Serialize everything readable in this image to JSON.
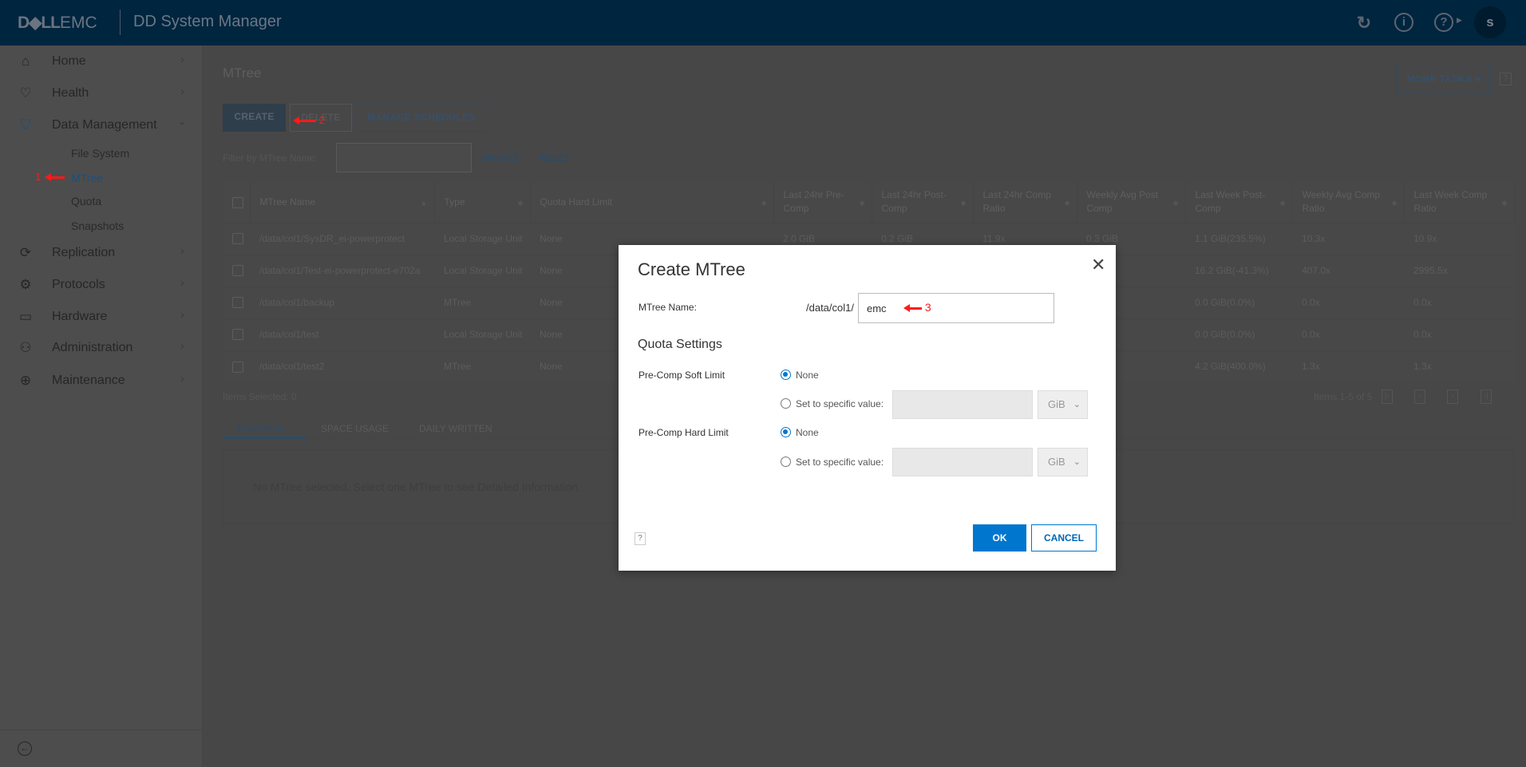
{
  "header": {
    "logo_bold": "D◆LL",
    "logo_light": "EMC",
    "title": "DD System Manager",
    "avatar": "s",
    "icons": [
      "refresh-icon",
      "info-icon",
      "help-icon"
    ]
  },
  "sidebar": {
    "items": [
      {
        "label": "Home",
        "icon": "home-icon"
      },
      {
        "label": "Health",
        "icon": "heart-icon"
      },
      {
        "label": "Data Management",
        "icon": "shield-icon",
        "expanded": true,
        "children": [
          "File System",
          "MTree",
          "Quota",
          "Snapshots"
        ],
        "active_child": "MTree"
      },
      {
        "label": "Replication",
        "icon": "sync-icon"
      },
      {
        "label": "Protocols",
        "icon": "protocols-icon"
      },
      {
        "label": "Hardware",
        "icon": "hardware-icon"
      },
      {
        "label": "Administration",
        "icon": "admin-icon"
      },
      {
        "label": "Maintenance",
        "icon": "maintenance-icon"
      }
    ]
  },
  "annotations": {
    "a1": "1",
    "a2": "2",
    "a3": "3"
  },
  "main": {
    "title": "MTree",
    "create": "CREATE",
    "delete": "DELETE",
    "manage": "MANAGE SCHEDULES",
    "more_tasks": "MORE TASKS",
    "help": "?",
    "filter_label": "Filter by MTree Name:",
    "filter_value": "",
    "update": "UPDATE",
    "reset": "RESET",
    "columns": [
      "MTree Name",
      "Type",
      "Quota Hard Limit",
      "Last 24hr Pre-Comp",
      "Last 24hr Post-Comp",
      "Last 24hr Comp Ratio",
      "Weekly Avg Post Comp",
      "Last Week Post-Comp",
      "Weekly Avg Comp Ratio",
      "Last Week Comp Ratio"
    ],
    "rows": [
      [
        "/data/col1/SysDR_ei-powerprotect",
        "Local Storage Unit",
        "None",
        "2.0 GiB",
        "0.2 GiB",
        "11.9x",
        "0.3 GiB",
        "1.1 GiB(235.5%)",
        "10.3x",
        "10.9x"
      ],
      [
        "/data/col1/Test-ei-powerprotect-e702a",
        "Local Storage Unit",
        "None",
        "",
        "",
        "",
        "",
        "16.2 GiB(-41.3%)",
        "407.0x",
        "2995.5x"
      ],
      [
        "/data/col1/backup",
        "MTree",
        "None",
        "",
        "",
        "",
        "",
        "0.0 GiB(0.0%)",
        "0.0x",
        "0.0x"
      ],
      [
        "/data/col1/test",
        "Local Storage Unit",
        "None",
        "",
        "",
        "",
        "",
        "0.0 GiB(0.0%)",
        "0.0x",
        "0.0x"
      ],
      [
        "/data/col1/test2",
        "MTree",
        "None",
        "",
        "",
        "",
        "",
        "4.2 GiB(400.0%)",
        "1.3x",
        "1.3x"
      ]
    ],
    "items_selected": "Items Selected: 0",
    "pagination": "Items 1-5 of 5",
    "tabs": [
      "SUMMARY",
      "SPACE USAGE",
      "DAILY WRITTEN"
    ],
    "summary_text": "No MTree selected. Select one MTree to see Detailed Information."
  },
  "dialog": {
    "title": "Create MTree",
    "name_label": "MTree Name:",
    "prefix": "/data/col1/",
    "name_value": "emc",
    "quota_heading": "Quota Settings",
    "soft_label": "Pre-Comp Soft Limit",
    "hard_label": "Pre-Comp Hard Limit",
    "none": "None",
    "specific": "Set to specific value:",
    "unit": "GiB",
    "soft_selected": "None",
    "hard_selected": "None",
    "ok": "OK",
    "cancel": "CANCEL",
    "help": "?"
  },
  "colors": {
    "accent": "#0076ce",
    "annotation": "#ff1a1a"
  }
}
